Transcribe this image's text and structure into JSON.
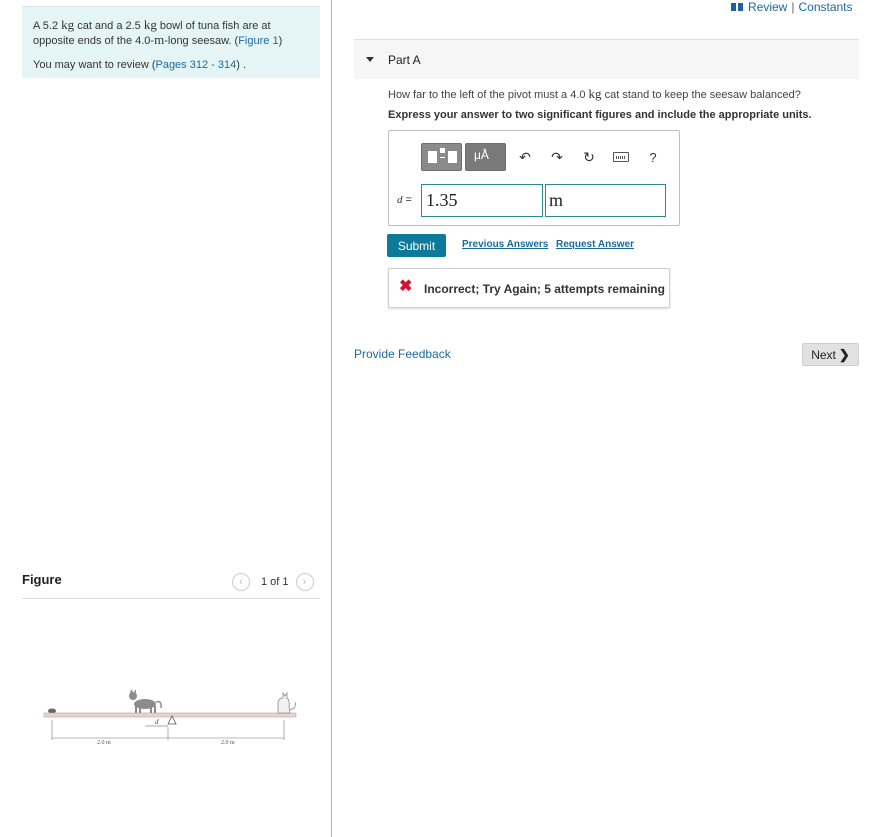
{
  "problem": {
    "text_1": "A 5.2 ",
    "unit_kg_1": "kg",
    "text_2": " cat and a 2.5 ",
    "unit_kg_2": "kg",
    "text_3": " bowl of tuna fish are at opposite ends of the 4.0-",
    "unit_m": "m",
    "text_4": "-long seesaw. (",
    "figure_link": "Figure 1",
    "text_5": ")",
    "review_prefix": "You may want to review (",
    "review_link": "Pages 312 - 314",
    "review_suffix": ") ."
  },
  "figure": {
    "title": "Figure",
    "count": "1 of 1",
    "prev_glyph": "‹",
    "next_glyph": "›",
    "diagram": {
      "left_dimension": "2.0 m",
      "right_dimension": "2.0 m",
      "d_label": "d"
    }
  },
  "top_links": {
    "review": "Review",
    "separator": "|",
    "constants": "Constants",
    "icon": "book-icon"
  },
  "part": {
    "title": "Part A"
  },
  "question": {
    "text_1": "How far to the left of the pivot must a 4.0 ",
    "unit": "kg",
    "text_2": " cat stand to keep the seesaw balanced?",
    "instruction": "Express your answer to two significant figures and include the appropriate units."
  },
  "toolbar": {
    "mu_label": "μÅ",
    "undo_glyph": "↶",
    "redo_glyph": "↷",
    "reset_glyph": "↻",
    "help_glyph": "?"
  },
  "answer": {
    "label_var": "d",
    "label_eq": " =",
    "value": "1.35",
    "unit": "m"
  },
  "actions": {
    "submit": "Submit",
    "previous_answers": "Previous Answers",
    "request_answer": "Request Answer"
  },
  "feedback": {
    "icon": "✖",
    "message": "Incorrect; Try Again; 5 attempts remaining"
  },
  "footer": {
    "provide_feedback": "Provide Feedback",
    "next": "Next",
    "next_glyph": "❯"
  },
  "colors": {
    "link": "#1a6aa0",
    "submit_bg": "#0d7a99",
    "input_border": "#2a8a8e",
    "error_red": "#d0142c",
    "problem_bg": "#e5f5f5"
  }
}
